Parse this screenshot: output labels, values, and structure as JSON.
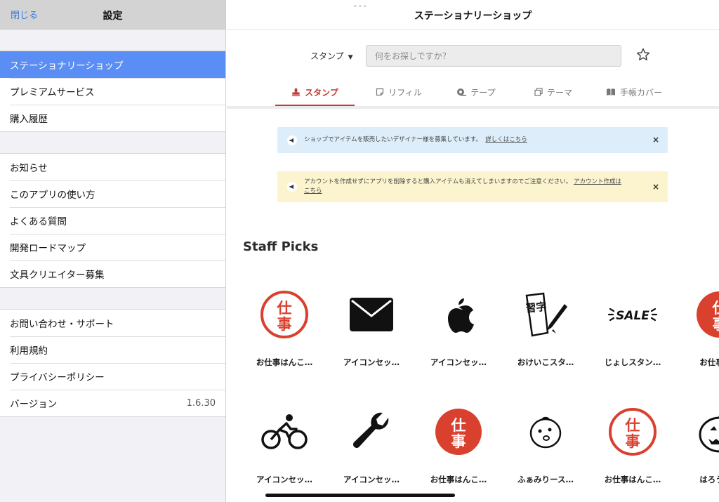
{
  "sidebar": {
    "close_label": "閉じる",
    "title": "設定",
    "groups": [
      [
        {
          "label": "ステーショナリーショップ",
          "active": true
        },
        {
          "label": "プレミアムサービス"
        },
        {
          "label": "購入履歴"
        }
      ],
      [
        {
          "label": "お知らせ"
        },
        {
          "label": "このアプリの使い方"
        },
        {
          "label": "よくある質問"
        },
        {
          "label": "開発ロードマップ"
        },
        {
          "label": "文具クリエイター募集"
        }
      ],
      [
        {
          "label": "お問い合わせ・サポート"
        },
        {
          "label": "利用規約"
        },
        {
          "label": "プライバシーポリシー"
        },
        {
          "label": "バージョン",
          "value": "1.6.30"
        }
      ]
    ]
  },
  "main": {
    "top_dots": "•••",
    "nav_title": "ステーショナリーショップ",
    "category_select": "スタンプ",
    "search_placeholder": "何をお探しですか？",
    "tabs": [
      {
        "label": "スタンプ",
        "icon": "stamp-icon",
        "active": true
      },
      {
        "label": "リフィル",
        "icon": "refill-icon"
      },
      {
        "label": "テープ",
        "icon": "tape-icon"
      },
      {
        "label": "テーマ",
        "icon": "theme-icon"
      },
      {
        "label": "手帳カバー",
        "icon": "book-cover-icon"
      }
    ],
    "banners": {
      "blue": {
        "text": "ショップでアイテムを販売したいデザイナー様を募集しています。",
        "link": "詳しくはこちら",
        "close": "×"
      },
      "yellow": {
        "text": "アカウントを作成せずにアプリを削除すると購入アイテムも消えてしまいますのでご注意ください。",
        "link": "アカウント作成はこちら",
        "close": "×"
      }
    },
    "section_title": "Staff Picks",
    "items_row1": [
      {
        "name": "お仕事はんこ…",
        "icon": "shigoto-stamp-icon"
      },
      {
        "name": "アイコンセッ…",
        "icon": "envelope-icon"
      },
      {
        "name": "アイコンセッ…",
        "icon": "apple-icon"
      },
      {
        "name": "おけいこスタ…",
        "icon": "calligraphy-icon"
      },
      {
        "name": "じょしスタン…",
        "icon": "sale-icon"
      },
      {
        "name": "お仕事は…",
        "icon": "shigoto-stamp-icon"
      }
    ],
    "items_row2": [
      {
        "name": "アイコンセッ…",
        "icon": "bicycle-icon"
      },
      {
        "name": "アイコンセッ…",
        "icon": "wrench-icon"
      },
      {
        "name": "お仕事はんこ…",
        "icon": "shigoto-stamp-icon"
      },
      {
        "name": "ふぁみりース…",
        "icon": "baby-face-icon"
      },
      {
        "name": "お仕事はんこ…",
        "icon": "shigoto-stamp-icon"
      },
      {
        "name": "はろうい…",
        "icon": "pumpkin-icon"
      }
    ],
    "stamp_glyphs": {
      "top": "仕",
      "bottom": "事"
    },
    "sale_text": "SALE",
    "calligraphy_text": "習字"
  },
  "colors": {
    "accent": "#c23a30",
    "sidebar_active": "#5a8ef5",
    "link": "#3a7bd5",
    "stamp_red": "#d9402e"
  }
}
